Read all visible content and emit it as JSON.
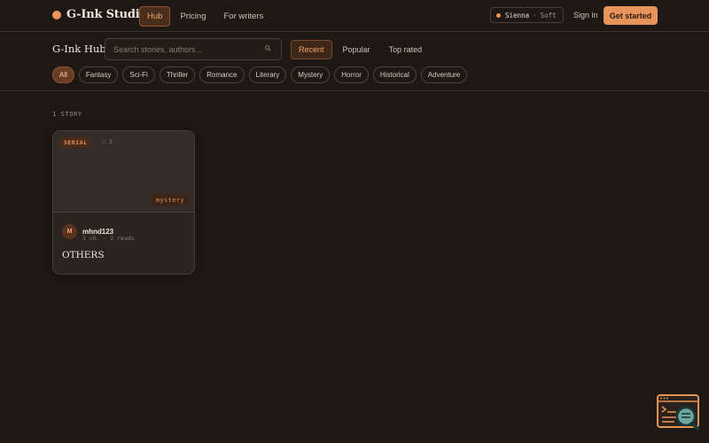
{
  "brand": {
    "name": "G-Ink Studio",
    "accent": "#e8935a"
  },
  "nav": {
    "items": [
      {
        "label": "Hub",
        "active": true
      },
      {
        "label": "Pricing",
        "active": false
      },
      {
        "label": "For writers",
        "active": false
      }
    ]
  },
  "theme": {
    "name": "Sienna",
    "mode": "Soft"
  },
  "auth": {
    "signin_label": "Sign in",
    "cta_label": "Get started"
  },
  "hub": {
    "title": "G-Ink Hub",
    "search_placeholder": "Search stories, authors...",
    "sort": [
      {
        "label": "Recent",
        "active": true
      },
      {
        "label": "Popular",
        "active": false
      },
      {
        "label": "Top rated",
        "active": false
      }
    ],
    "genres": [
      {
        "label": "All",
        "active": true
      },
      {
        "label": "Fantasy",
        "active": false
      },
      {
        "label": "Sci-Fi",
        "active": false
      },
      {
        "label": "Thriller",
        "active": false
      },
      {
        "label": "Romance",
        "active": false
      },
      {
        "label": "Literary",
        "active": false
      },
      {
        "label": "Mystery",
        "active": false
      },
      {
        "label": "Horror",
        "active": false
      },
      {
        "label": "Historical",
        "active": false
      },
      {
        "label": "Adventure",
        "active": false
      }
    ]
  },
  "results": {
    "count_label": "1 STORY",
    "stories": [
      {
        "badge": "SERIAL",
        "chapters_mini": "☐ 2",
        "genre": "mystery",
        "author_initial": "M",
        "author": "mhnd123",
        "meta": "2 ch. · 2 reads",
        "title": "OTHERS"
      }
    ]
  }
}
